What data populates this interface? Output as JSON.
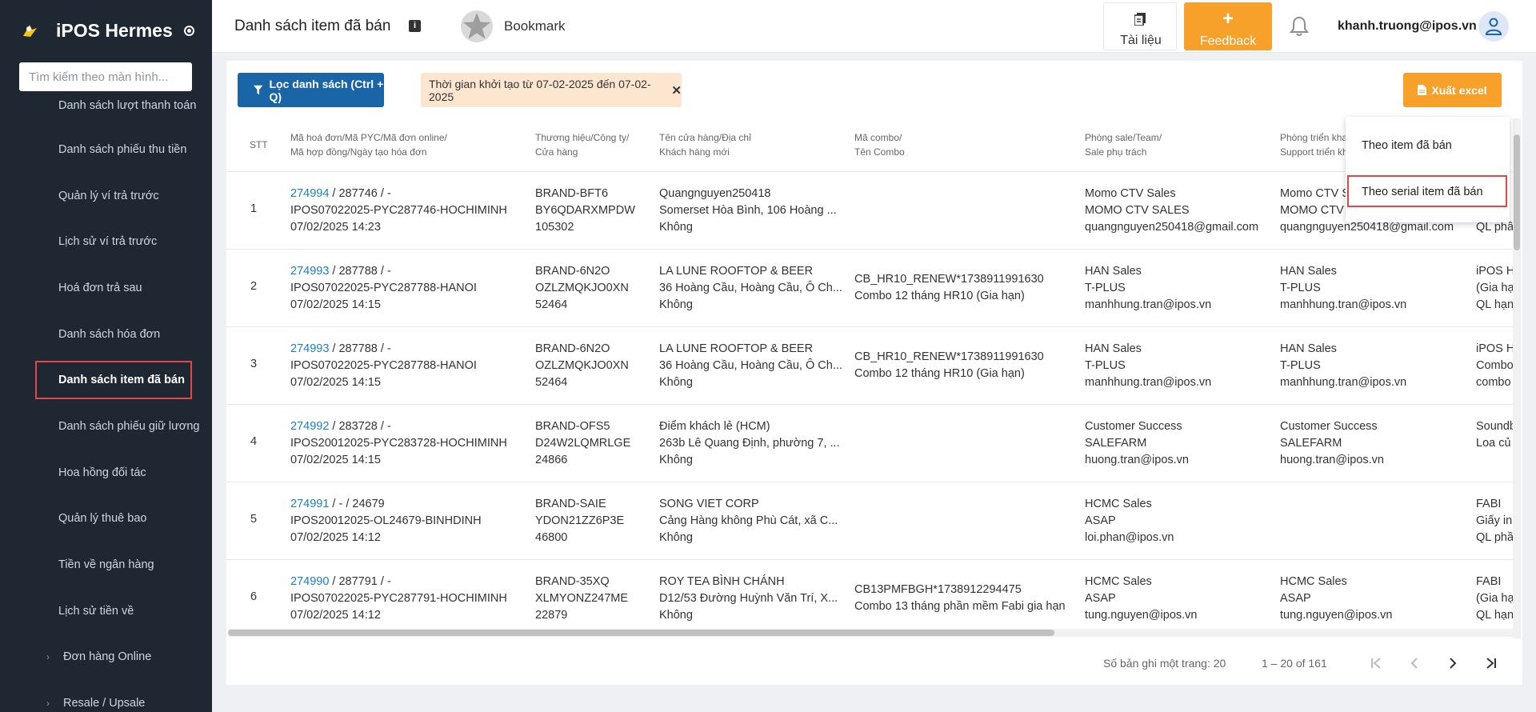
{
  "sidebar": {
    "brand": "iPOS Hermes",
    "search_placeholder": "Tìm kiếm theo màn hình...",
    "items": [
      {
        "label": "Danh sách lượt thanh toán"
      },
      {
        "label": "Danh sách phiếu thu tiền"
      },
      {
        "label": "Quản lý ví trả trước"
      },
      {
        "label": "Lịch sử ví trả trước"
      },
      {
        "label": "Hoá đơn trả sau"
      },
      {
        "label": "Danh sách hóa đơn"
      },
      {
        "label": "Danh sách item đã bán"
      },
      {
        "label": "Danh sách phiếu giữ lương"
      },
      {
        "label": "Hoa hồng đối tác"
      },
      {
        "label": "Quản lý thuê bao"
      },
      {
        "label": "Tiền về ngân hàng"
      },
      {
        "label": "Lịch sử tiền về"
      },
      {
        "label": "Đơn hàng Online"
      },
      {
        "label": "Resale / Upsale"
      }
    ]
  },
  "header": {
    "title": "Danh sách item đã bán",
    "bookmark": "Bookmark",
    "docs_label": "Tài liệu",
    "feedback_label": "Feedback",
    "feedback_plus": "+",
    "user_email": "khanh.truong@ipos.vn",
    "info_glyph": "i"
  },
  "toolbar": {
    "filter_label": "Lọc danh sách (Ctrl + Q)",
    "filter_chip": "Thời gian khởi tạo từ 07-02-2025 đến 07-02-2025",
    "chip_close": "✕",
    "excel_label": "Xuất excel"
  },
  "table": {
    "headers": {
      "stt": "STT",
      "invoice_1": "Mã hoá đơn/Mã PYC/Mã đơn online/",
      "invoice_2": "Mã hợp đồng/Ngày tạo hóa đơn",
      "brand_1": "Thương hiệu/Công ty/",
      "brand_2": "Cửa hàng",
      "store_1": "Tên cửa hàng/Địa chỉ",
      "store_2": "Khách hàng mới",
      "combo_1": "Mã combo/",
      "combo_2": "Tên Combo",
      "sale_1": "Phòng sale/Team/",
      "sale_2": "Sale phụ trách",
      "deploy_1": "Phòng triển kha",
      "deploy_2": "Support triển kh"
    },
    "rows": [
      {
        "stt": "1",
        "inv_id": "274994",
        "inv_rest": " / 287746 / -",
        "inv_l2": "IPOS07022025-PYC287746-HOCHIMINH",
        "inv_l3": "07/02/2025 14:23",
        "b1": "BRAND-BFT6",
        "b2": "BY6QDARXMPDW",
        "b3": "105302",
        "s1": "Quangnguyen250418",
        "s2": "Somerset Hòa Bình, 106 Hoàng ...",
        "s3": "Không",
        "c1": "",
        "c2": "",
        "sa1": "Momo CTV Sales",
        "sa2": "MOMO CTV SALES",
        "sa3": "quangnguyen250418@gmail.com",
        "d1": "Momo CTV S",
        "d2": "MOMO CTV S",
        "d3": "quangnguyen250418@gmail.com",
        "e1": "",
        "e2": "",
        "e3": "QL phầ"
      },
      {
        "stt": "2",
        "inv_id": "274993",
        "inv_rest": " / 287788 / -",
        "inv_l2": "IPOS07022025-PYC287788-HANOI",
        "inv_l3": "07/02/2025 14:15",
        "b1": "BRAND-6N2O",
        "b2": "OZLZMQKJO0XN",
        "b3": "52464",
        "s1": "LA LUNE ROOFTOP & BEER",
        "s2": "36 Hoàng Cầu, Hoàng Cầu, Ô Ch...",
        "s3": "Không",
        "c1": "CB_HR10_RENEW*1738911991630",
        "c2": "Combo 12 tháng HR10 (Gia hạn)",
        "sa1": "HAN Sales",
        "sa2": "T-PLUS",
        "sa3": "manhhung.tran@ipos.vn",
        "d1": "HAN Sales",
        "d2": "T-PLUS",
        "d3": "manhhung.tran@ipos.vn",
        "e1": "iPOS H",
        "e2": "(Gia hạ",
        "e3": "QL hạn"
      },
      {
        "stt": "3",
        "inv_id": "274993",
        "inv_rest": " / 287788 / -",
        "inv_l2": "IPOS07022025-PYC287788-HANOI",
        "inv_l3": "07/02/2025 14:15",
        "b1": "BRAND-6N2O",
        "b2": "OZLZMQKJO0XN",
        "b3": "52464",
        "s1": "LA LUNE ROOFTOP & BEER",
        "s2": "36 Hoàng Cầu, Hoàng Cầu, Ô Ch...",
        "s3": "Không",
        "c1": "CB_HR10_RENEW*1738911991630",
        "c2": "Combo 12 tháng HR10 (Gia hạn)",
        "sa1": "HAN Sales",
        "sa2": "T-PLUS",
        "sa3": "manhhung.tran@ipos.vn",
        "d1": "HAN Sales",
        "d2": "T-PLUS",
        "d3": "manhhung.tran@ipos.vn",
        "e1": "iPOS H",
        "e2": "Combo",
        "e3": "combo"
      },
      {
        "stt": "4",
        "inv_id": "274992",
        "inv_rest": " / 283728 / -",
        "inv_l2": "IPOS20012025-PYC283728-HOCHIMINH",
        "inv_l3": "07/02/2025 14:15",
        "b1": "BRAND-OFS5",
        "b2": "D24W2LQMRLGE",
        "b3": "24866",
        "s1": "Điểm khách lẻ (HCM)",
        "s2": "263b Lê Quang Định, phường 7, ...",
        "s3": "Không",
        "c1": "",
        "c2": "",
        "sa1": "Customer Success",
        "sa2": "SALEFARM",
        "sa3": "huong.tran@ipos.vn",
        "d1": "Customer Success",
        "d2": "SALEFARM",
        "d3": "huong.tran@ipos.vn",
        "e1": "Soundb",
        "e2": "Loa củ",
        "e3": ""
      },
      {
        "stt": "5",
        "inv_id": "274991",
        "inv_rest": " / - / 24679",
        "inv_l2": "IPOS20012025-OL24679-BINHDINH",
        "inv_l3": "07/02/2025 14:12",
        "b1": "BRAND-SAIE",
        "b2": "YDON21ZZ6P3E",
        "b3": "46800",
        "s1": "SONG VIET CORP",
        "s2": "Cảng Hàng không Phù Cát, xã C...",
        "s3": "Không",
        "c1": "",
        "c2": "",
        "sa1": "HCMC Sales",
        "sa2": "ASAP",
        "sa3": "loi.phan@ipos.vn",
        "d1": "",
        "d2": "",
        "d3": "",
        "e1": "FABI",
        "e2": "Giấy in",
        "e3": "QL phầ"
      },
      {
        "stt": "6",
        "inv_id": "274990",
        "inv_rest": " / 287791 / -",
        "inv_l2": "IPOS07022025-PYC287791-HOCHIMINH",
        "inv_l3": "07/02/2025 14:12",
        "b1": "BRAND-35XQ",
        "b2": "XLMYONZ247ME",
        "b3": "22879",
        "s1": "ROY TEA BÌNH CHÁNH",
        "s2": "D12/53 Đường Huỳnh Văn Trí, X...",
        "s3": "Không",
        "c1": "CB13PMFBGH*1738912294475",
        "c2": "Combo 13 tháng phần mềm Fabi gia hạn",
        "sa1": "HCMC Sales",
        "sa2": "ASAP",
        "sa3": "tung.nguyen@ipos.vn",
        "d1": "HCMC Sales",
        "d2": "ASAP",
        "d3": "tung.nguyen@ipos.vn",
        "e1": "FABI",
        "e2": "(Gia hạ",
        "e3": "QL hạn"
      }
    ]
  },
  "pager": {
    "page_size": "Số bản ghi một trang: 20",
    "range": "1 – 20 of 161"
  },
  "dropdown": {
    "items": [
      {
        "label": "Theo item đã bán"
      },
      {
        "label": "Theo serial item đã bán"
      }
    ]
  }
}
